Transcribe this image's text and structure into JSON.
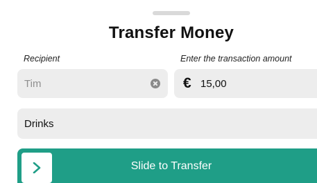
{
  "sheet": {
    "title": "Transfer Money"
  },
  "recipient": {
    "label": "Recipient",
    "placeholder": "Tim",
    "clear_icon": "clear-circle-icon"
  },
  "amount": {
    "label": "Enter the transaction amount",
    "currency_symbol": "€",
    "value": "15,00"
  },
  "note": {
    "value": "Drinks"
  },
  "slider": {
    "label": "Slide to Transfer",
    "handle_icon": "chevron-right-icon",
    "color": "#1f9e87"
  }
}
